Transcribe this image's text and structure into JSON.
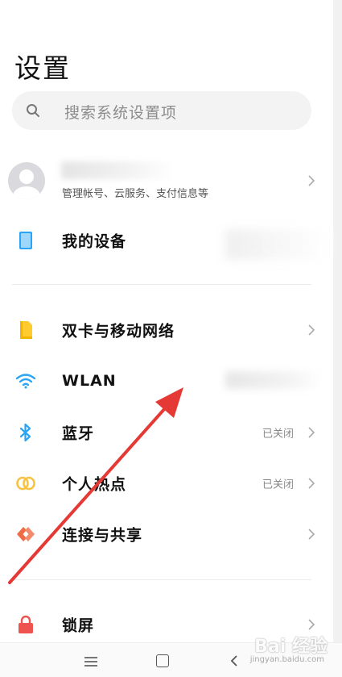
{
  "page": {
    "title": "设置"
  },
  "search": {
    "placeholder": "搜索系统设置项"
  },
  "account": {
    "subtitle": "管理帐号、云服务、支付信息等"
  },
  "items": [
    {
      "label": "我的设备",
      "icon": "device-icon"
    },
    {
      "label": "双卡与移动网络",
      "icon": "sim-card-icon"
    },
    {
      "label": "WLAN",
      "icon": "wifi-icon"
    },
    {
      "label": "蓝牙",
      "icon": "bluetooth-icon",
      "value": "已关闭"
    },
    {
      "label": "个人热点",
      "icon": "hotspot-icon",
      "value": "已关闭"
    },
    {
      "label": "连接与共享",
      "icon": "share-icon"
    },
    {
      "label": "锁屏",
      "icon": "lock-icon"
    }
  ],
  "watermark": {
    "text": "Bai 经验",
    "sub": "jingyan.baidu.com"
  },
  "colors": {
    "accent_blue": "#2aa4f4",
    "sim_yellow": "#f4b400",
    "hotspot_yellow": "#f6c343",
    "share_orange": "#ef6b45",
    "lock_red": "#ef5350",
    "arrow_red": "#e53935"
  }
}
